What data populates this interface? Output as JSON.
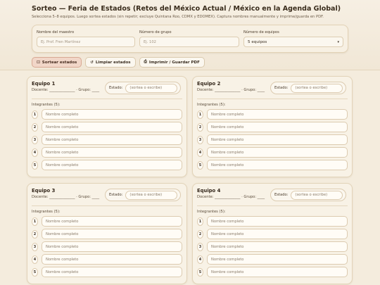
{
  "header": {
    "title": "Sorteo — Feria de Estados (Retos del México Actual / México en la Agenda Global)",
    "subtitle": "Selecciona 5–8 equipos. Luego sortea estados (sin repetir; excluye Quintana Roo, CDMX y EDOMEX). Captura nombres manualmente y imprime/guarda en PDF."
  },
  "form": {
    "teacher_label": "Nombre del maestro",
    "teacher_placeholder": "Ej. Prof. Fren Martínez",
    "group_label": "Número de grupo",
    "group_placeholder": "Ej. 102",
    "teams_label": "Número de equipos",
    "teams_value": "5 equipos"
  },
  "toolbar": {
    "draw_icon": "dice-icon",
    "draw_label": "Sortear estados",
    "clear_icon": "refresh-icon",
    "clear_label": "Limpiar estados",
    "print_icon": "printer-icon",
    "print_label": "Imprimir / Guardar PDF"
  },
  "team_card": {
    "meta": "Docente: ______________ · Grupo: ____",
    "state_label": "Estado:",
    "state_placeholder": "(sortea o escribe)",
    "members_label": "Integrantes (5):",
    "member_placeholder": "Nombre completo",
    "member_numbers": [
      "1",
      "2",
      "3",
      "4",
      "5"
    ]
  },
  "teams": [
    {
      "name": "Equipo 1"
    },
    {
      "name": "Equipo 2"
    },
    {
      "name": "Equipo 3"
    },
    {
      "name": "Equipo 4"
    }
  ],
  "colors": {
    "background": "#f4ecdd",
    "card": "#f8f2e6",
    "primary_button": "#f1d6c8",
    "border": "#e2d3b8"
  }
}
